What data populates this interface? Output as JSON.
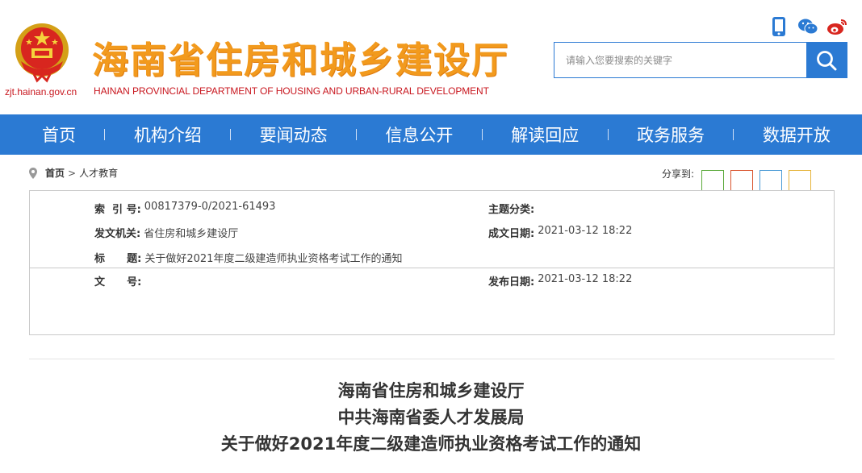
{
  "header": {
    "domain": "zjt.hainan.gov.cn",
    "title": "海南省住房和城乡建设厅",
    "subtitle": "HAINAN PROVINCIAL DEPARTMENT OF HOUSING AND URBAN-RURAL DEVELOPMENT",
    "search_placeholder": "请输入您要搜索的关键字",
    "social_icons": [
      "mobile-icon",
      "wechat-icon",
      "weibo-icon"
    ]
  },
  "nav": {
    "items": [
      "首页",
      "机构介绍",
      "要闻动态",
      "信息公开",
      "解读回应",
      "政务服务",
      "数据开放"
    ]
  },
  "breadcrumb": {
    "home": "首页",
    "current": "人才教育"
  },
  "share": {
    "label": "分享到:",
    "colors": [
      "#5aa93a",
      "#d9542e",
      "#4a9bd6",
      "#e6b43b"
    ]
  },
  "meta": {
    "index_label": "索  引 号:",
    "index_value": "00817379-0/2021-61493",
    "topic_label": "主题分类:",
    "topic_value": "",
    "issuer_label": "发文机关:",
    "issuer_value": "省住房和城乡建设厅",
    "created_label": "成文日期:",
    "created_value": "2021-03-12 18:22",
    "title_label": "标      题:",
    "title_value": "关于做好2021年度二级建造师执业资格考试工作的通知",
    "docno_label": "文      号:",
    "docno_value": "",
    "published_label": "发布日期:",
    "published_value": "2021-03-12 18:22"
  },
  "article": {
    "line1": "海南省住房和城乡建设厅",
    "line2": "中共海南省委人才发展局",
    "line3": "关于做好2021年度二级建造师执业资格考试工作的通知"
  },
  "colors": {
    "brand_blue": "#2b7ad3",
    "title_orange": "#f29a1d",
    "accent_red": "#c8161e"
  }
}
